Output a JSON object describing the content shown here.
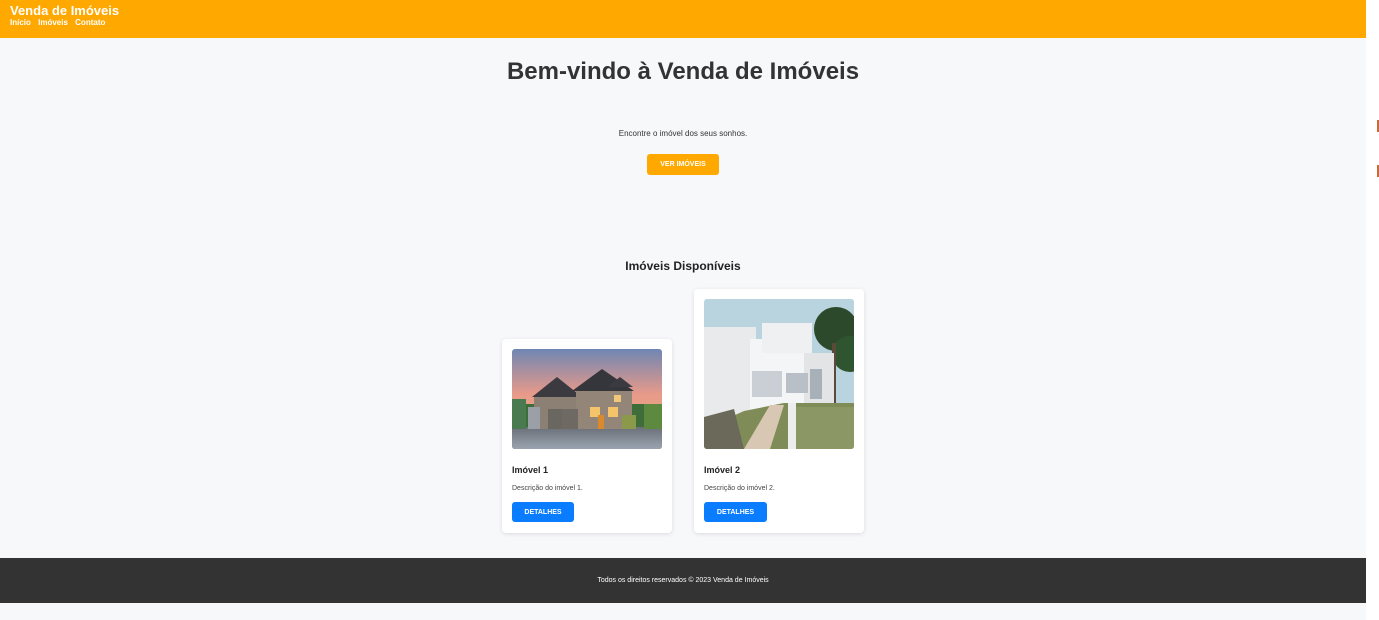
{
  "header": {
    "site_title": "Venda de Imóveis",
    "nav": [
      "Início",
      "Imóveis",
      "Contato"
    ]
  },
  "hero": {
    "title": "Bem-vindo à Venda de Imóveis",
    "subtitle": "Encontre o imóvel dos seus sonhos.",
    "cta_label": "VER IMÓVEIS"
  },
  "listings": {
    "title": "Imóveis Disponíveis",
    "properties": [
      {
        "name": "Imóvel 1",
        "description": "Descrição do imóvel 1.",
        "button_label": "DETALHES"
      },
      {
        "name": "Imóvel 2",
        "description": "Descrição do imóvel 2.",
        "button_label": "DETALHES"
      }
    ]
  },
  "footer": {
    "text": "Todos os direitos reservados © 2023 Venda de Imóveis"
  },
  "colors": {
    "header_bg": "#ffa800",
    "button_blue": "#0a7cff",
    "footer_bg": "#333333",
    "page_bg": "#f7f8fa"
  }
}
